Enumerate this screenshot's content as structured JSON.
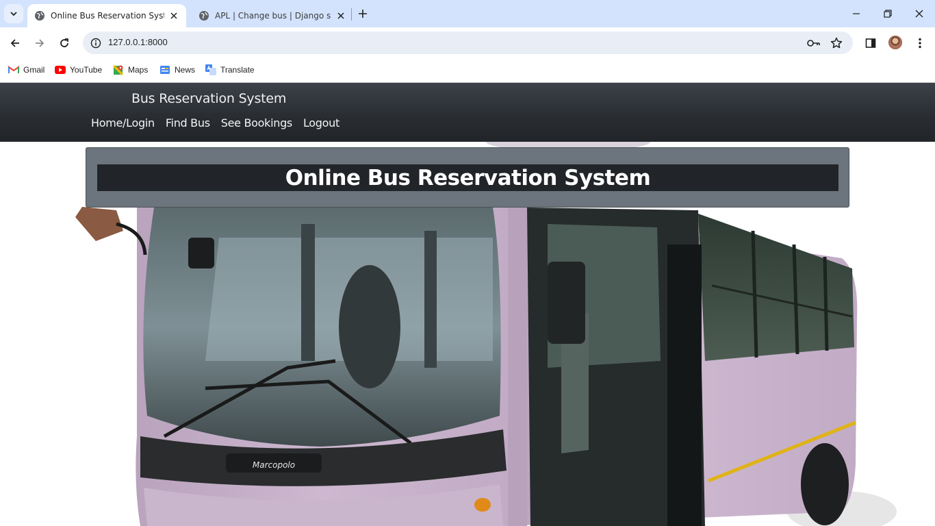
{
  "browser": {
    "tabs": [
      {
        "title": "Online Bus Reservation System",
        "active": true,
        "icon": "globe-icon"
      },
      {
        "title": "APL | Change bus | Django site admin",
        "active": false,
        "icon": "globe-icon"
      }
    ],
    "address": {
      "url": "127.0.0.1:8000"
    },
    "bookmarks": [
      {
        "label": "Gmail",
        "icon": "gmail-icon"
      },
      {
        "label": "YouTube",
        "icon": "youtube-icon"
      },
      {
        "label": "Maps",
        "icon": "maps-icon"
      },
      {
        "label": "News",
        "icon": "news-icon"
      },
      {
        "label": "Translate",
        "icon": "translate-icon"
      }
    ]
  },
  "site": {
    "brand": "Bus Reservation System",
    "nav": [
      {
        "label": "Home/Login"
      },
      {
        "label": "Find Bus"
      },
      {
        "label": "See Bookings"
      },
      {
        "label": "Logout"
      }
    ],
    "hero_title": "Online Bus Reservation System",
    "hero_image": "bus-photo"
  },
  "colors": {
    "tabstrip": "#d3e3fd",
    "navbar": "#212529",
    "jumbotron": "#6c757d",
    "bus_body": "#c9b3cc"
  }
}
